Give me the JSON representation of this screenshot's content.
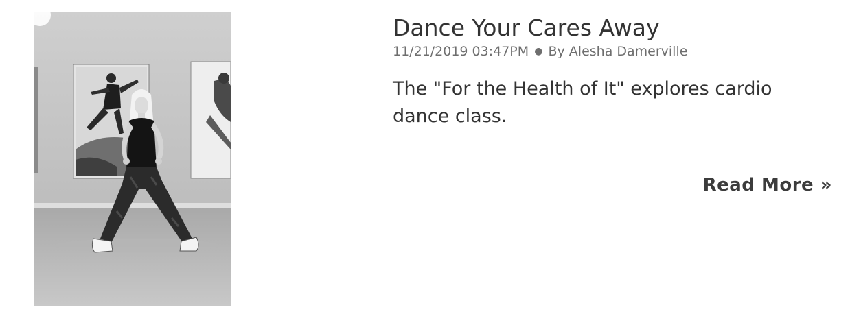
{
  "post": {
    "title": "Dance Your Cares Away",
    "date": "11/21/2019 03:47PM",
    "separator": "●",
    "byline": "By Alesha Damerville",
    "excerpt": "The \"For the Health of It\" explores cardio dance class.",
    "read_more": "Read More »",
    "image": "black-and-white photo of a woman in a wide dance stance in a studio"
  }
}
